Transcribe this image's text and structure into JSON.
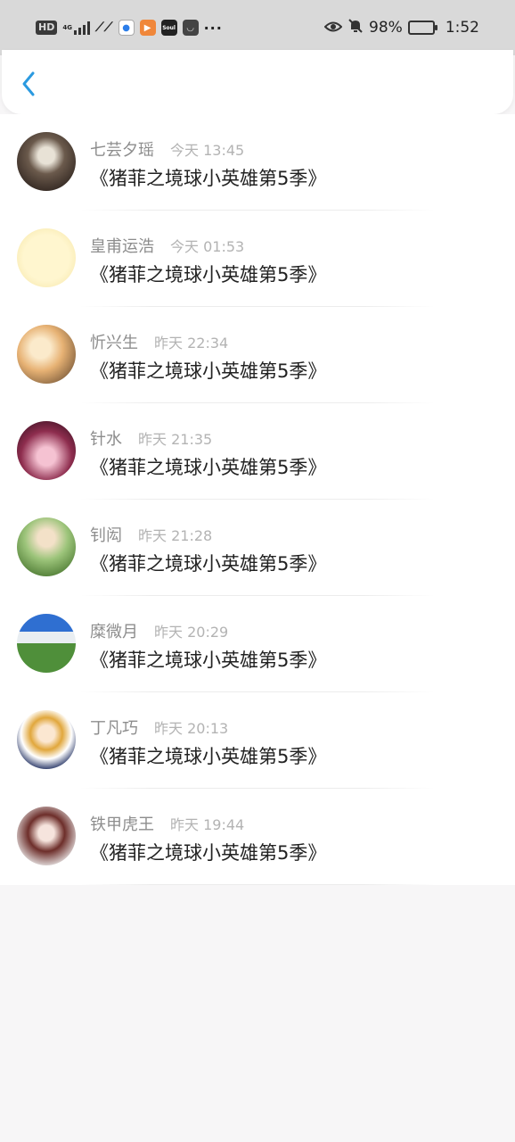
{
  "status_bar": {
    "hd": "HD",
    "network": "4G",
    "apps": [
      "app-icon",
      "browser-icon",
      "video-icon",
      "soul-icon",
      "notification-icon"
    ],
    "app_soul_label": "Soul",
    "more": "···",
    "battery": "98%",
    "time": "1:52"
  },
  "header": {
    "back_icon": "chevron-left-icon",
    "accent": "#2b9ae0"
  },
  "items": [
    {
      "name": "七芸夕瑶",
      "time": "今天 13:45",
      "title": "《猪菲之境球小英雄第5季》"
    },
    {
      "name": "皇甫运浩",
      "time": "今天 01:53",
      "title": "《猪菲之境球小英雄第5季》"
    },
    {
      "name": "忻兴生",
      "time": "昨天 22:34",
      "title": "《猪菲之境球小英雄第5季》"
    },
    {
      "name": "针水",
      "time": "昨天 21:35",
      "title": "《猪菲之境球小英雄第5季》"
    },
    {
      "name": "钊闳",
      "time": "昨天 21:28",
      "title": "《猪菲之境球小英雄第5季》"
    },
    {
      "name": "糜微月",
      "time": "昨天 20:29",
      "title": "《猪菲之境球小英雄第5季》"
    },
    {
      "name": "丁凡巧",
      "time": "昨天 20:13",
      "title": "《猪菲之境球小英雄第5季》"
    },
    {
      "name": "铁甲虎王",
      "time": "昨天 19:44",
      "title": "《猪菲之境球小英雄第5季》"
    }
  ]
}
